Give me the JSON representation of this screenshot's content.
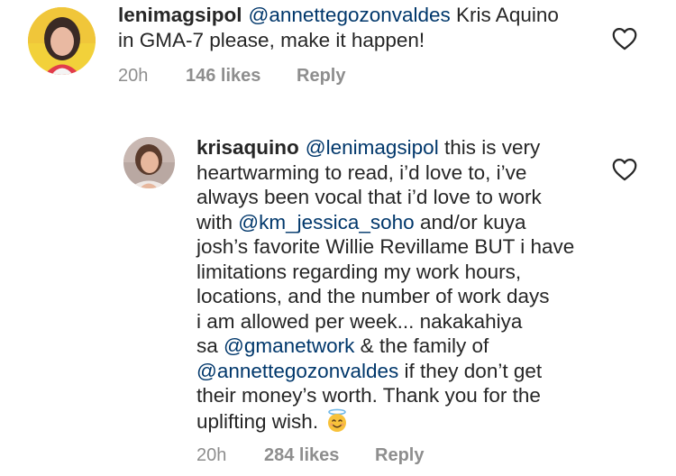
{
  "comments": [
    {
      "username": "lenimagsipol",
      "mention": "@annettegozonvaldes",
      "text_line1_rest": " Kris Aquino",
      "text_line2": "in GMA-7 please, make it happen!",
      "time": "20h",
      "likes": "146 likes",
      "reply": "Reply"
    },
    {
      "username": "krisaquino",
      "lines": {
        "l1_mention": "@lenimagsipol",
        "l1_rest": " this is very",
        "l2": "heartwarming to read, i’d love to, i’ve",
        "l3": "always been vocal that i’d love to work",
        "l4_pre": "with ",
        "l4_mention": "@km_jessica_soho",
        "l4_rest": " and/or kuya",
        "l5": "josh’s favorite Willie Revillame BUT i have",
        "l6": "limitations regarding my work hours,",
        "l7": "locations, and the number of work days",
        "l8": "i am allowed per week... nakakahiya",
        "l9_pre": "sa ",
        "l9_mention": "@gmanetwork",
        "l9_rest": " & the family of",
        "l10_mention": "@annettegozonvaldes",
        "l10_rest": " if they don’t get",
        "l11": "their money’s worth. Thank you for the",
        "l12": "uplifting wish."
      },
      "emoji": "smiling-face-with-halo",
      "time": "20h",
      "likes": "284 likes",
      "reply": "Reply"
    }
  ],
  "icons": {
    "like": "heart-outline-icon"
  },
  "colors": {
    "text": "#262626",
    "mention": "#00376b",
    "meta": "#8e8e8e"
  }
}
